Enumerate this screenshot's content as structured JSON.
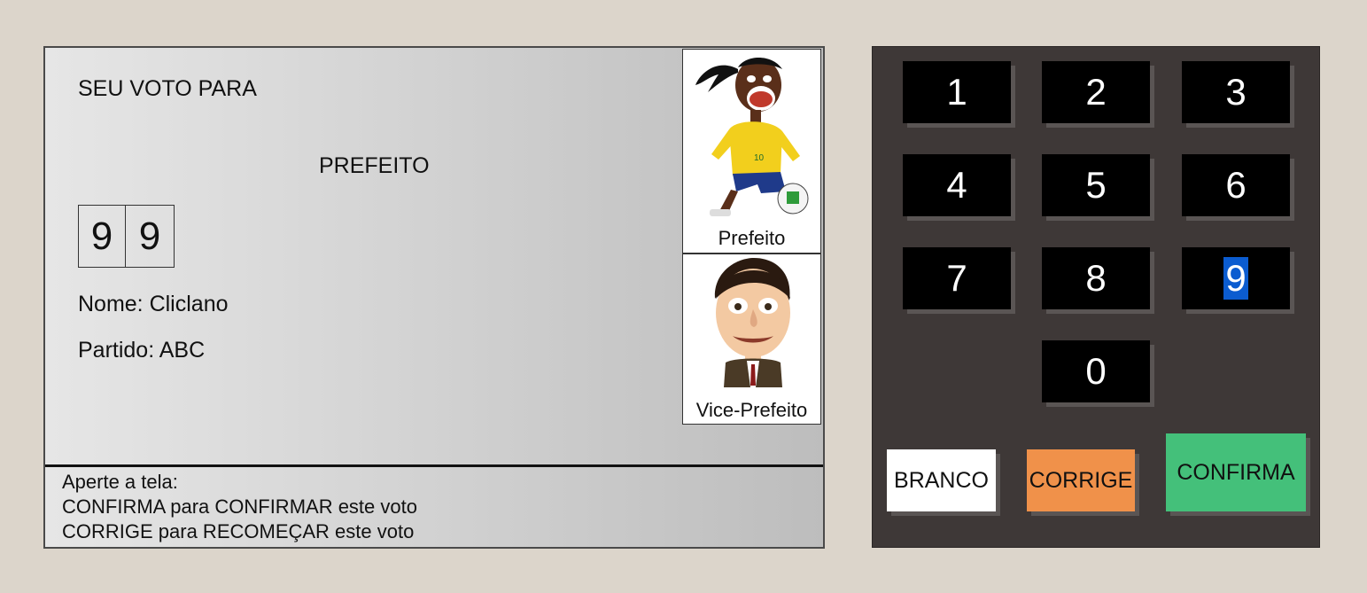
{
  "screen": {
    "header": "SEU VOTO PARA",
    "role": "PREFEITO",
    "digits": [
      "9",
      "9"
    ],
    "name_line": "Nome: Cliclano",
    "party_line": "Partido: ABC",
    "photos": {
      "prefeito": {
        "caption": "Prefeito",
        "icon": "soccer-player-caricature"
      },
      "vice": {
        "caption": "Vice-Prefeito",
        "icon": "man-caricature"
      }
    },
    "instructions": {
      "line1": "Aperte a tela:",
      "line2": "CONFIRMA para CONFIRMAR este voto",
      "line3": "CORRIGE para RECOMEÇAR este voto"
    }
  },
  "keypad": {
    "keys": [
      "1",
      "2",
      "3",
      "4",
      "5",
      "6",
      "7",
      "8",
      "9",
      "0"
    ],
    "selected_key": "9",
    "branco": "BRANCO",
    "corrige": "CORRIGE",
    "confirma": "CONFIRMA",
    "colors": {
      "branco": "#ffffff",
      "corrige": "#f0914a",
      "confirma": "#44c07a",
      "selection": "#0b5cd0"
    }
  }
}
